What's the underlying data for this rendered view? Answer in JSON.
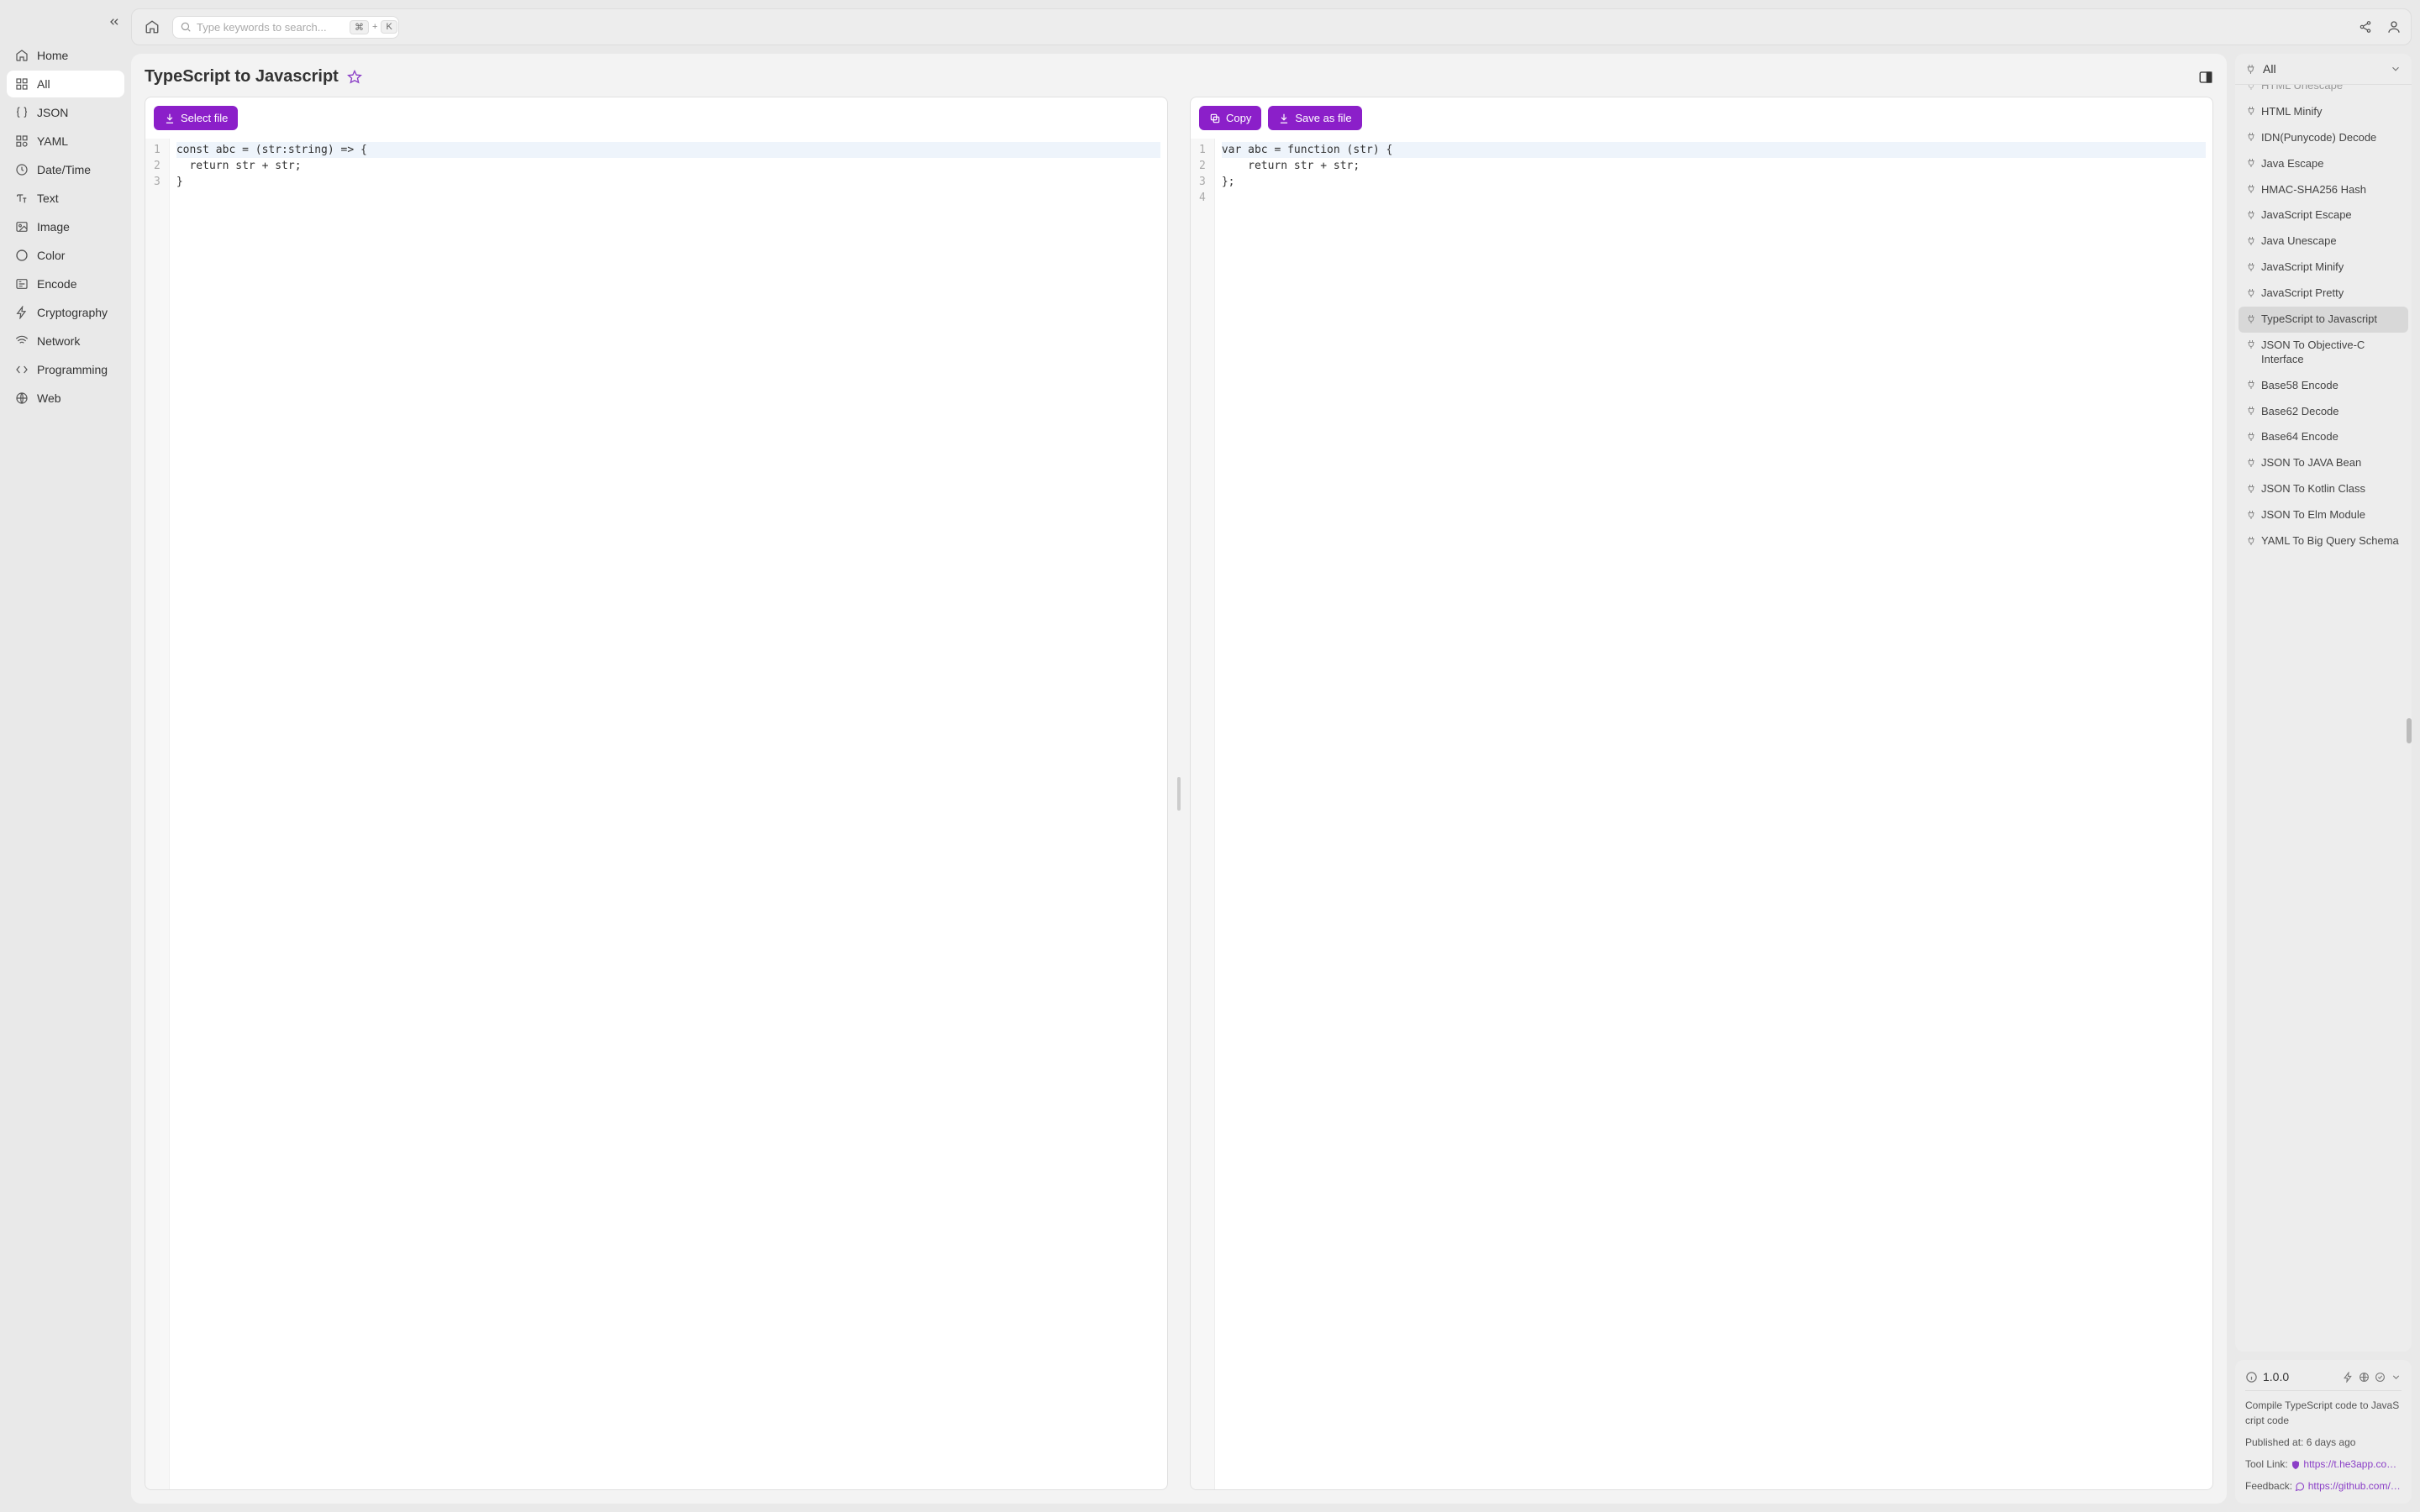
{
  "sidebar": {
    "items": [
      {
        "id": "home",
        "label": "Home"
      },
      {
        "id": "all",
        "label": "All",
        "active": true
      },
      {
        "id": "json",
        "label": "JSON"
      },
      {
        "id": "yaml",
        "label": "YAML"
      },
      {
        "id": "datetime",
        "label": "Date/Time"
      },
      {
        "id": "text",
        "label": "Text"
      },
      {
        "id": "image",
        "label": "Image"
      },
      {
        "id": "color",
        "label": "Color"
      },
      {
        "id": "encode",
        "label": "Encode"
      },
      {
        "id": "crypto",
        "label": "Cryptography"
      },
      {
        "id": "network",
        "label": "Network"
      },
      {
        "id": "programming",
        "label": "Programming"
      },
      {
        "id": "web",
        "label": "Web"
      }
    ]
  },
  "search": {
    "placeholder": "Type keywords to search...",
    "shortcut_mod": "⌘",
    "shortcut_plus": "+",
    "shortcut_key": "K"
  },
  "page": {
    "title": "TypeScript to Javascript"
  },
  "toolbar": {
    "select_file": "Select file",
    "copy": "Copy",
    "save_as_file": "Save as file"
  },
  "editor_left": {
    "lines": [
      "const abc = (str:string) => {",
      "  return str + str;",
      "}"
    ]
  },
  "editor_right": {
    "lines": [
      "var abc = function (str) {",
      "    return str + str;",
      "};",
      ""
    ]
  },
  "tools_filter": {
    "label": "All"
  },
  "tools": [
    {
      "label": "HTML Unescape",
      "clipped": true
    },
    {
      "label": "HTML Minify"
    },
    {
      "label": "IDN(Punycode) Decode"
    },
    {
      "label": "Java Escape"
    },
    {
      "label": "HMAC-SHA256 Hash"
    },
    {
      "label": "JavaScript Escape"
    },
    {
      "label": "Java Unescape"
    },
    {
      "label": "JavaScript Minify"
    },
    {
      "label": "JavaScript Pretty"
    },
    {
      "label": "TypeScript to Javascript",
      "selected": true
    },
    {
      "label": "JSON To Objective-C Interface"
    },
    {
      "label": "Base58 Encode"
    },
    {
      "label": "Base62 Decode"
    },
    {
      "label": "Base64 Encode"
    },
    {
      "label": "JSON To JAVA Bean"
    },
    {
      "label": "JSON To Kotlin Class"
    },
    {
      "label": "JSON To Elm Module"
    },
    {
      "label": "YAML To Big Query Schema"
    }
  ],
  "info": {
    "version": "1.0.0",
    "description": "Compile TypeScript code to JavaScript code",
    "published_label": "Published at:",
    "published_value": "6 days ago",
    "tool_link_label": "Tool Link:",
    "tool_link_value": "https://t.he3app.co…",
    "feedback_label": "Feedback:",
    "feedback_value": "https://github.com/…"
  }
}
